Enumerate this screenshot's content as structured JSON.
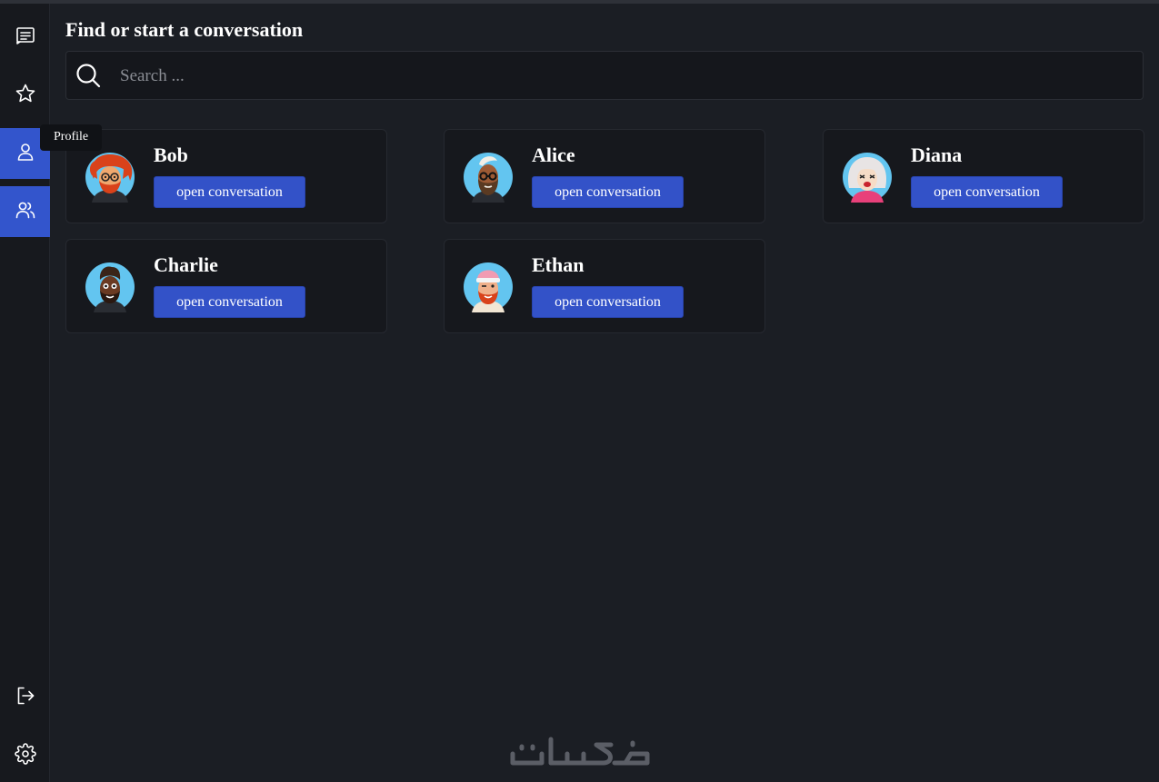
{
  "sidebar": {
    "items": [
      {
        "icon": "messages-icon",
        "active": false
      },
      {
        "icon": "star-icon",
        "active": false
      },
      {
        "icon": "user-icon",
        "active": true,
        "tooltip": "Profile"
      },
      {
        "icon": "users-icon",
        "active": true
      },
      {
        "icon": "logout-icon",
        "active": false
      },
      {
        "icon": "gear-icon",
        "active": false
      }
    ],
    "tooltip": "Profile",
    "active_color": "#3355cc"
  },
  "main": {
    "title": "Find or start a conversation",
    "search": {
      "placeholder": "Search ...",
      "value": ""
    },
    "contacts": [
      {
        "name": "Bob",
        "button_label": "open conversation"
      },
      {
        "name": "Alice",
        "button_label": "open conversation"
      },
      {
        "name": "Diana",
        "button_label": "open conversation"
      },
      {
        "name": "Charlie",
        "button_label": "open conversation"
      },
      {
        "name": "Ethan",
        "button_label": "open conversation"
      }
    ]
  },
  "colors": {
    "background": "#1b1e24",
    "sidebar": "#17191e",
    "card": "#16181d",
    "button": "#3352c8",
    "avatar_bg": "#63c5f0"
  },
  "watermark": "خمسات"
}
